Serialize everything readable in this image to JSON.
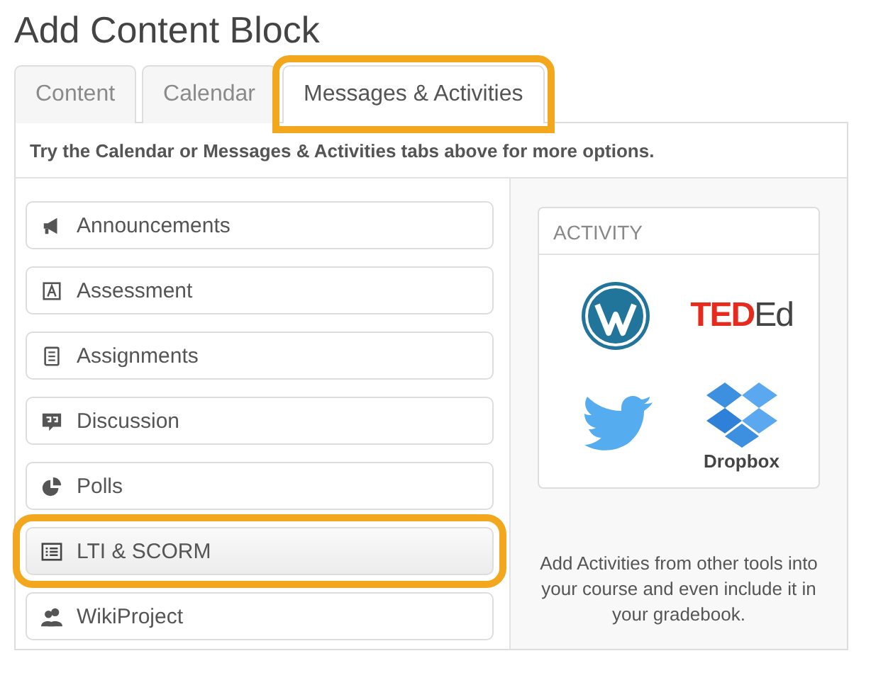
{
  "title": "Add Content Block",
  "tabs": [
    {
      "label": "Content",
      "selected": false,
      "highlighted": false
    },
    {
      "label": "Calendar",
      "selected": false,
      "highlighted": false
    },
    {
      "label": "Messages & Activities",
      "selected": true,
      "highlighted": true
    }
  ],
  "hint": "Try the Calendar or Messages & Activities tabs above for more options.",
  "items": [
    {
      "label": "Announcements",
      "highlighted": false
    },
    {
      "label": "Assessment",
      "highlighted": false
    },
    {
      "label": "Assignments",
      "highlighted": false
    },
    {
      "label": "Discussion",
      "highlighted": false
    },
    {
      "label": "Polls",
      "highlighted": false
    },
    {
      "label": "LTI & SCORM",
      "highlighted": true
    },
    {
      "label": "WikiProject",
      "highlighted": false
    }
  ],
  "activity": {
    "heading": "ACTIVITY",
    "tiles": [
      {
        "kind": "round-logo"
      },
      {
        "kind": "wordmark",
        "bold": "TED",
        "light": "Ed"
      },
      {
        "kind": "bird"
      },
      {
        "kind": "box",
        "caption": "Dropbox"
      }
    ],
    "note": "Add Activities from other tools into your course and even include it in your gradebook."
  }
}
